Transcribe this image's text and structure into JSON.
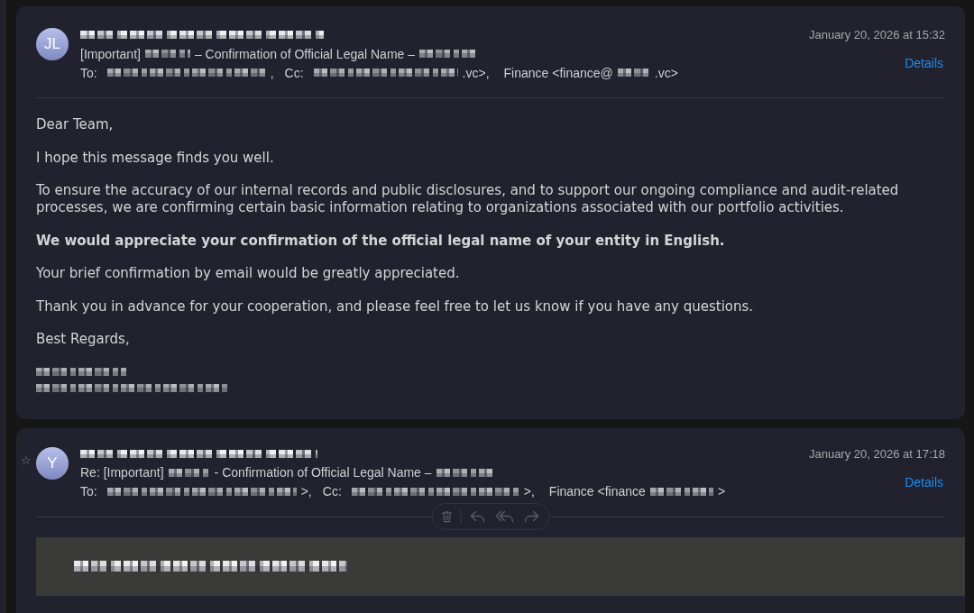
{
  "messages": [
    {
      "avatar": {
        "initials": "JL"
      },
      "sender": [
        {
          "kind": "redacted"
        }
      ],
      "subject": [
        {
          "kind": "text",
          "text": "[Important]"
        },
        {
          "kind": "redacted"
        },
        {
          "kind": "text",
          "text": "– Confirmation of Official Legal Name –"
        },
        {
          "kind": "redacted"
        }
      ],
      "recipients": [
        {
          "kind": "label",
          "text": "To:"
        },
        {
          "kind": "redacted"
        },
        {
          "kind": "text",
          "text": ","
        },
        {
          "kind": "label",
          "text": "Cc:"
        },
        {
          "kind": "redacted"
        },
        {
          "kind": "text",
          "text": ".vc>,"
        },
        {
          "kind": "text",
          "text": "Finance <finance@"
        },
        {
          "kind": "redacted"
        },
        {
          "kind": "text",
          "text": ".vc>"
        }
      ],
      "date": "January 20, 2026 at 15:32",
      "details": "Details",
      "body": [
        {
          "kind": "text",
          "text": "Dear Team,"
        },
        {
          "kind": "text",
          "text": "I hope this message finds you well."
        },
        {
          "kind": "text",
          "text": "To ensure the accuracy of our internal records and public disclosures, and to support our ongoing compliance and audit-related processes, we are confirming certain basic information relating to organizations associated with our portfolio activities."
        },
        {
          "kind": "bold",
          "text": "We would appreciate your confirmation of the official legal name of your entity in English."
        },
        {
          "kind": "text",
          "text": "Your brief confirmation by email would be greatly appreciated."
        },
        {
          "kind": "text",
          "text": "Thank you in advance for your cooperation, and please feel free to let us know if you have any questions."
        },
        {
          "kind": "text",
          "text": "Best Regards,"
        },
        {
          "kind": "signature",
          "lines": [
            {
              "kind": "redacted"
            },
            {
              "kind": "redacted"
            }
          ]
        }
      ]
    },
    {
      "star": "☆",
      "avatar": {
        "initials": "Y"
      },
      "sender": [
        {
          "kind": "redacted"
        }
      ],
      "subject": [
        {
          "kind": "text",
          "text": "Re: [Important]"
        },
        {
          "kind": "redacted"
        },
        {
          "kind": "text",
          "text": "- Confirmation of Official Legal Name –"
        },
        {
          "kind": "redacted"
        }
      ],
      "recipients": [
        {
          "kind": "label",
          "text": "To:"
        },
        {
          "kind": "redacted"
        },
        {
          "kind": "text",
          "text": ">,"
        },
        {
          "kind": "label",
          "text": "Cc:"
        },
        {
          "kind": "redacted"
        },
        {
          "kind": "text",
          "text": ">,"
        },
        {
          "kind": "text",
          "text": "Finance <finance"
        },
        {
          "kind": "redacted"
        },
        {
          "kind": "text",
          "text": ">"
        }
      ],
      "date": "January 20, 2026 at 17:18",
      "details": "Details",
      "hover_actions": true,
      "body": [
        {
          "kind": "quote",
          "lines": [
            {
              "kind": "redacted"
            }
          ]
        }
      ]
    }
  ]
}
